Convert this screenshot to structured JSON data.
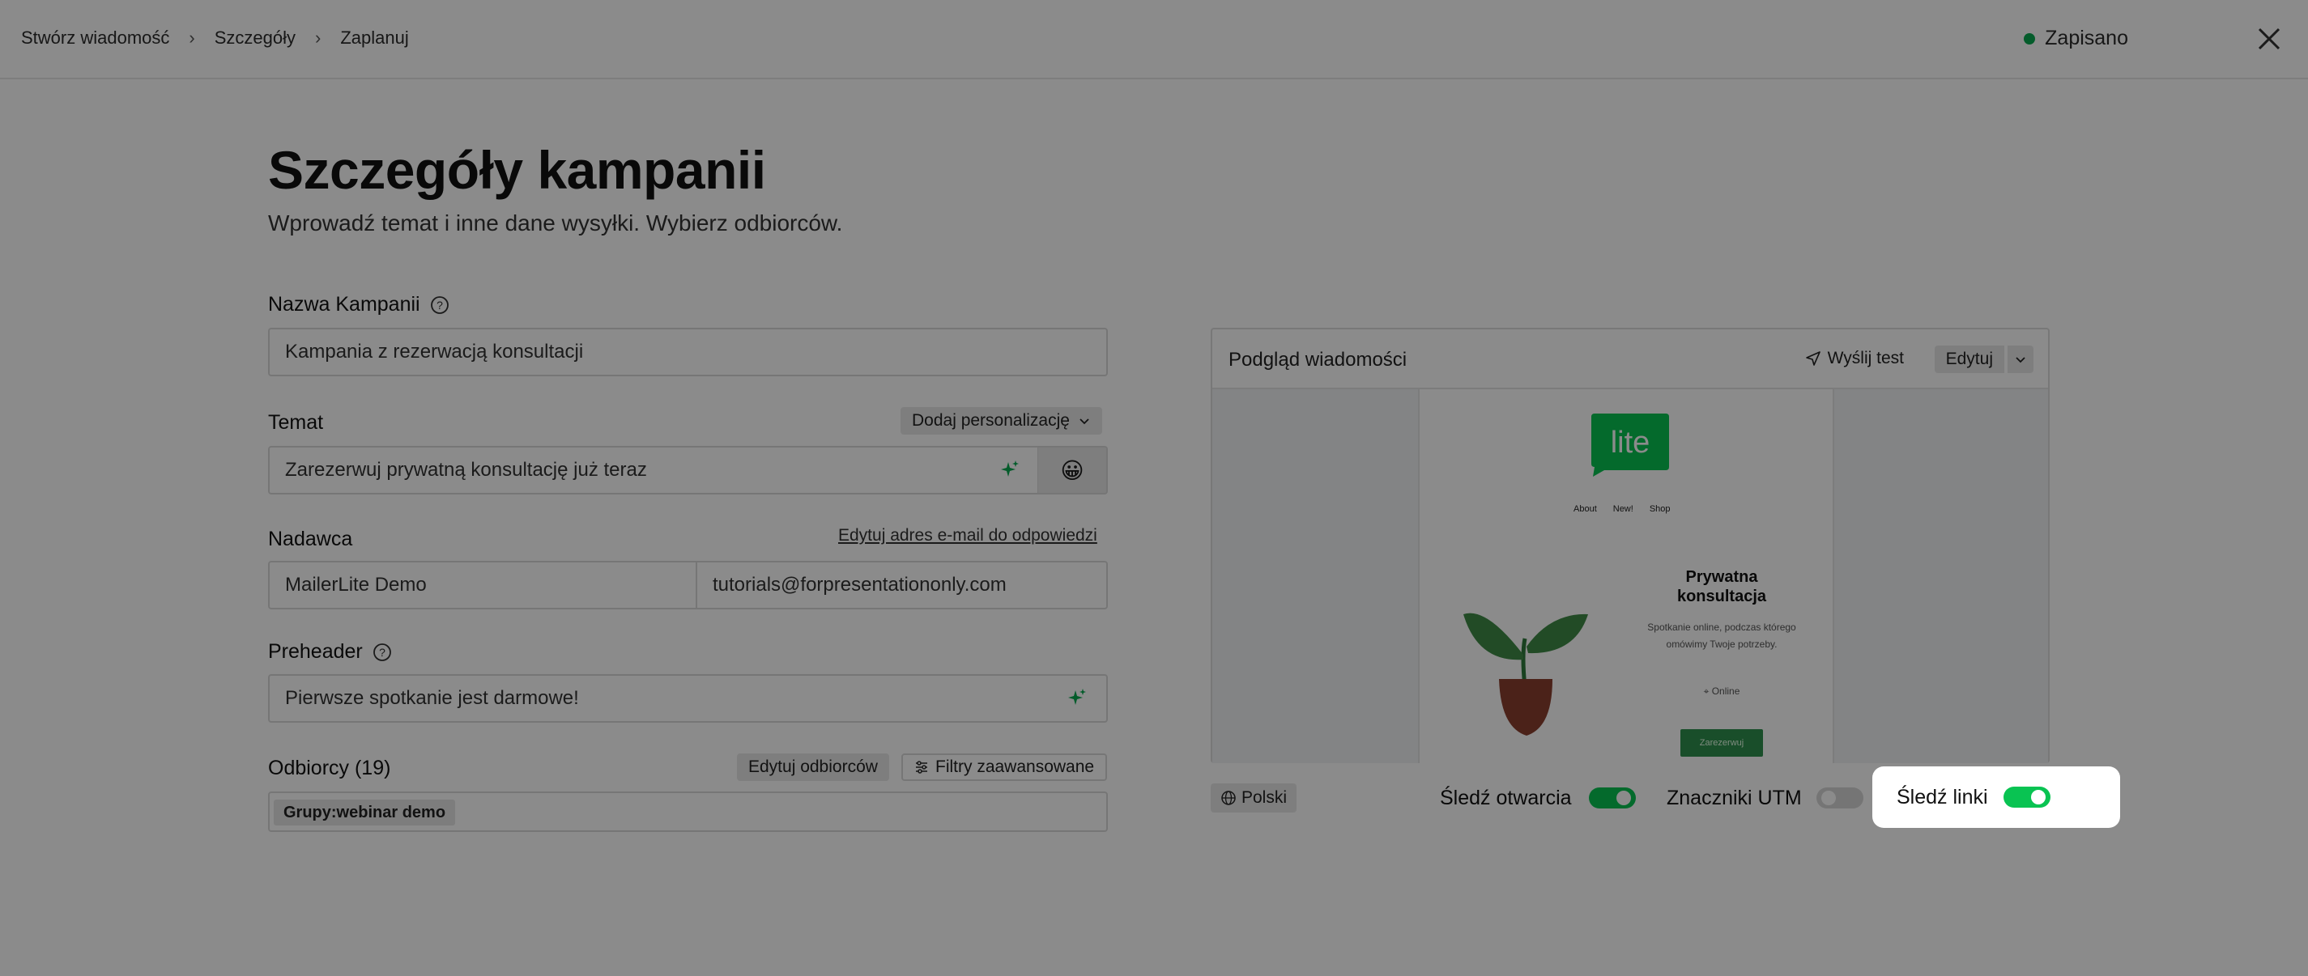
{
  "breadcrumb": [
    "Stwórz wiadomość",
    "Szczegóły",
    "Zaplanuj"
  ],
  "status": {
    "label": "Zapisano",
    "color": "#09a94f"
  },
  "page": {
    "title": "Szczegóły kampanii",
    "subtitle": "Wprowadź temat i inne dane wysyłki. Wybierz odbiorców."
  },
  "form": {
    "campaign_name": {
      "label": "Nazwa Kampanii",
      "value": "Kampania z rezerwacją konsultacji"
    },
    "subject": {
      "label": "Temat",
      "personalize_label": "Dodaj personalizację",
      "value": "Zarezerwuj prywatną konsultację już teraz",
      "emoji": "😀"
    },
    "sender": {
      "label": "Nadawca",
      "edit_reply_link": "Edytuj adres e-mail do odpowiedzi",
      "name": "MailerLite Demo",
      "email": "tutorials@forpresentationonly.com"
    },
    "preheader": {
      "label": "Preheader",
      "value": "Pierwsze spotkanie jest darmowe!"
    },
    "recipients": {
      "label": "Odbiorcy (19)",
      "edit_button": "Edytuj odbiorców",
      "filters_button": "Filtry zaawansowane",
      "chip": "Grupy:webinar demo"
    }
  },
  "preview": {
    "title": "Podgląd wiadomości",
    "send_test": "Wyślij test",
    "edit": "Edytuj",
    "email": {
      "logo_text": "lite",
      "nav": [
        "About",
        "New!",
        "Shop"
      ],
      "heading": "Prywatna konsultacja",
      "text": "Spotkanie online, podczas którego omówimy Twoje potrzeby.",
      "online": "Online",
      "button": "Zarezerwuj"
    }
  },
  "bottom": {
    "language": "Polski",
    "track_opens": {
      "label": "Śledź otwarcia",
      "on": true
    },
    "utm": {
      "label": "Znaczniki UTM",
      "on": false
    },
    "track_links": {
      "label": "Śledź linki",
      "on": true
    }
  },
  "colors": {
    "accent": "#09c352",
    "overlay": "rgba(0,0,0,0.455)"
  }
}
